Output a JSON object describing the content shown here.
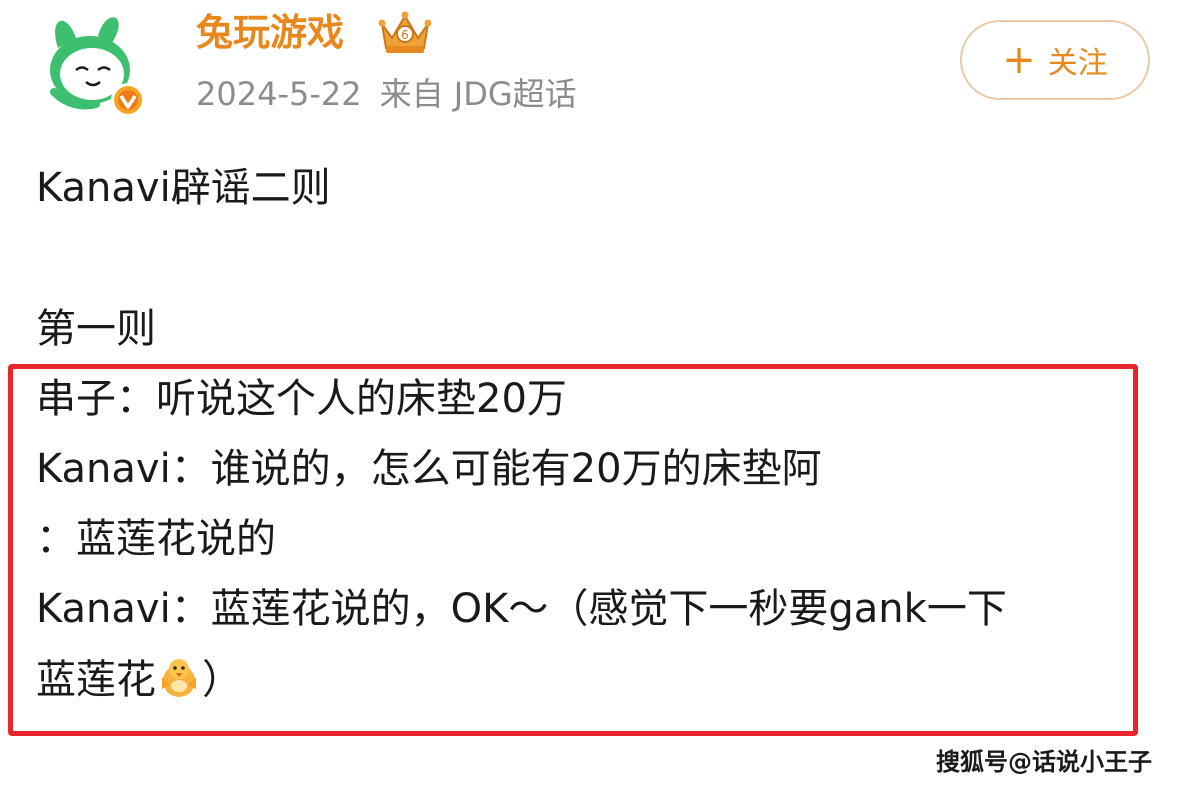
{
  "header": {
    "username": "兔玩游戏",
    "date": "2024-5-22",
    "source": "来自 JDG超话",
    "follow_icon": "+",
    "follow_label": "关注",
    "avatar_icon": "rabbit-avatar-icon",
    "badge_icon": "verified-v-badge-icon",
    "crown_icon": "crown-icon"
  },
  "post": {
    "title": "Kanavi辟谣二则",
    "part": "第一则",
    "lines": [
      "串子：听说这个人的床垫20万",
      "Kanavi：谁说的，怎么可能有20万的床垫阿",
      "：蓝莲花说的",
      "Kanavi：蓝莲花说的，OK～（感觉下一秒要gank一下",
      "蓝莲花",
      "）"
    ],
    "emoji_icon": "chick-emoji-icon"
  },
  "watermark": "搜狐号@话说小王子",
  "colors": {
    "accent": "#e8881c",
    "meta": "#8c8c8c",
    "highlight_border": "#e9242c",
    "avatar_green": "#3cbf6e"
  }
}
